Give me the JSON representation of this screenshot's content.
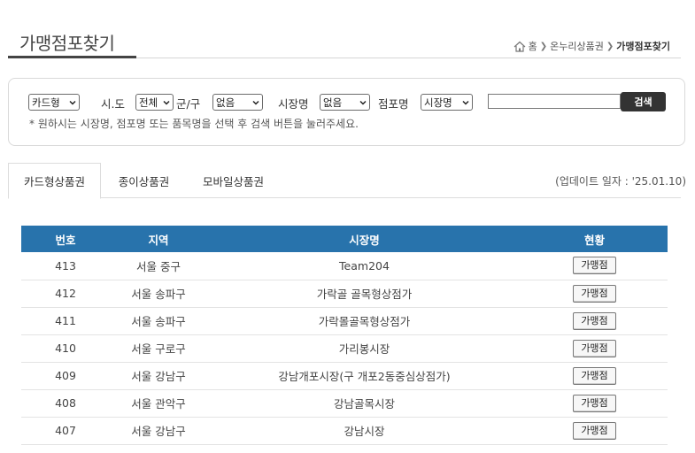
{
  "header": {
    "title": "가맹점포찾기",
    "breadcrumb": [
      "홈",
      "온누리상품권",
      "가맹점포찾기"
    ]
  },
  "search": {
    "type_select": "카드형",
    "sido_label": "시.도",
    "sido_select": "전체",
    "gungu_label": "군/구",
    "gungu_select": "없음",
    "market_label": "시장명",
    "market_select": "없음",
    "store_label": "점포명",
    "store_select": "시장명",
    "keyword_value": "",
    "button_label": "검색",
    "help_text": "* 원하시는 시장명, 점포명 또는 품목명을 선택 후 검색 버튼을 눌러주세요."
  },
  "tabs": [
    {
      "label": "카드형상품권",
      "active": true
    },
    {
      "label": "종이상품권",
      "active": false
    },
    {
      "label": "모바일상품권",
      "active": false
    }
  ],
  "update_text": "(업데이트 일자 : '25.01.10)",
  "table": {
    "headers": [
      "번호",
      "지역",
      "시장명",
      "현황"
    ],
    "rows": [
      {
        "no": "413",
        "area": "서울 중구",
        "market": "Team204",
        "status": "가맹점"
      },
      {
        "no": "412",
        "area": "서울 송파구",
        "market": "가락골 골목형상점가",
        "status": "가맹점"
      },
      {
        "no": "411",
        "area": "서울 송파구",
        "market": "가락몰골목형상점가",
        "status": "가맹점"
      },
      {
        "no": "410",
        "area": "서울 구로구",
        "market": "가리봉시장",
        "status": "가맹점"
      },
      {
        "no": "409",
        "area": "서울 강남구",
        "market": "강남개포시장(구 개포2동중심상점가)",
        "status": "가맹점"
      },
      {
        "no": "408",
        "area": "서울 관악구",
        "market": "강남골목시장",
        "status": "가맹점"
      },
      {
        "no": "407",
        "area": "서울 강남구",
        "market": "강남시장",
        "status": "가맹점"
      }
    ]
  },
  "colors": {
    "accent": "#2873ac",
    "button_dark": "#333333"
  }
}
